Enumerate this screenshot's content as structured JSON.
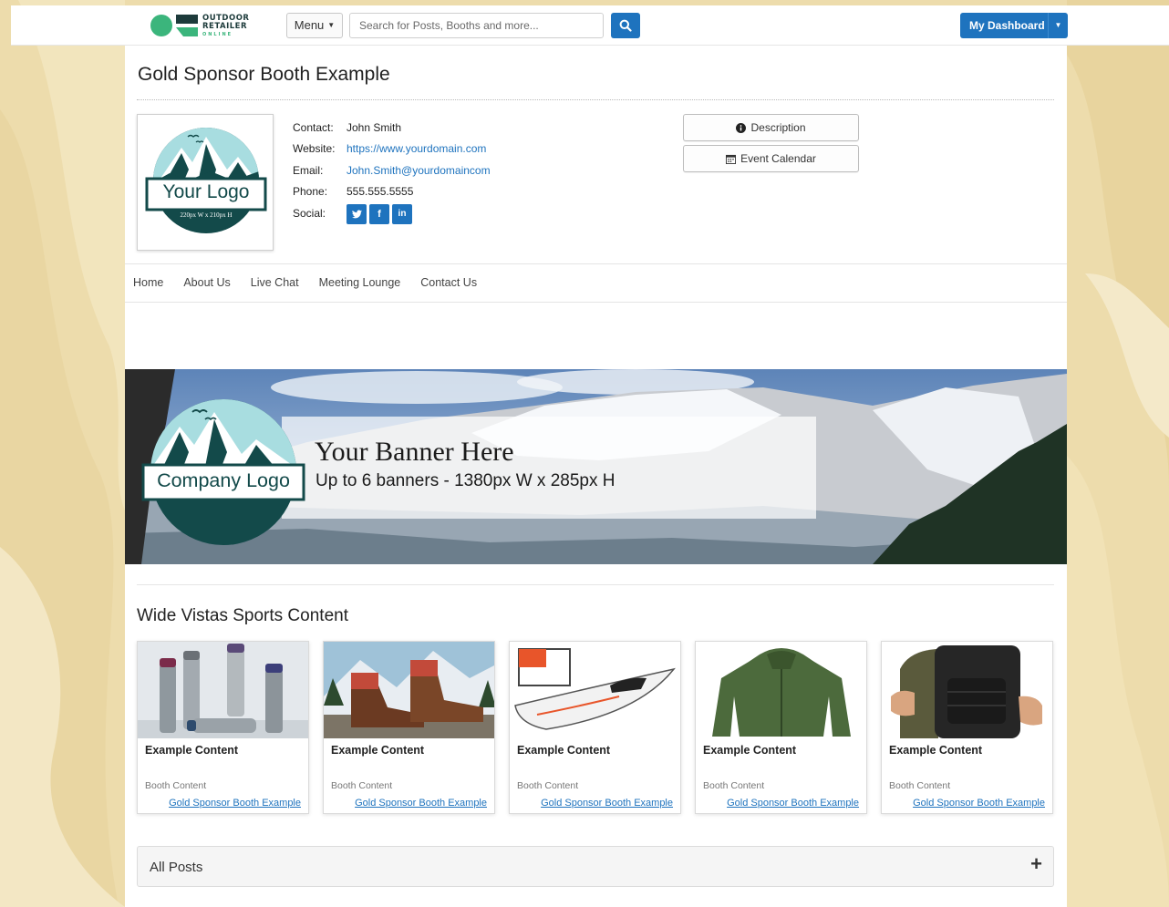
{
  "colors": {
    "background": "#eddcac",
    "primary": "#1e73be",
    "logo_teal": "#134a4a",
    "logo_green": "#3bb57c",
    "card_border": "#dadada"
  },
  "topbar": {
    "logo_alt": "Outdoor Retailer Online",
    "logo_line1": "OUTDOOR",
    "logo_line2": "RETAILER",
    "logo_line3": "ONLINE",
    "menu_label": "Menu",
    "search_placeholder": "Search for Posts, Booths and more...",
    "search_icon": "search-icon",
    "dashboard_label": "My Dashboard"
  },
  "booth": {
    "title": "Gold Sponsor Booth Example",
    "logo": {
      "main_text": "Your Logo",
      "size_text": "220px W x 210px H"
    },
    "contact": {
      "contact_label": "Contact:",
      "contact_value": "John Smith",
      "website_label": "Website:",
      "website_value": "https://www.yourdomain.com",
      "email_label": "Email:",
      "email_value": "John.Smith@yourdomaincom",
      "phone_label": "Phone:",
      "phone_value": "555.555.5555",
      "social_label": "Social:",
      "social_icons": [
        "twitter-icon",
        "facebook-icon",
        "linkedin-icon"
      ]
    },
    "buttons": {
      "description": "Description",
      "event_calendar": "Event Calendar"
    },
    "tabs": [
      "Home",
      "About Us",
      "Live Chat",
      "Meeting Lounge",
      "Contact Us"
    ]
  },
  "banner": {
    "logo_text": "Company Logo",
    "title": "Your Banner Here",
    "subtitle": "Up to 6 banners - 1380px W x 285px H"
  },
  "content_section": {
    "title": "Wide Vistas Sports Content",
    "cards": [
      {
        "image": "water-bottles",
        "title": "Example Content",
        "booth_label": "Booth Content",
        "link": "Gold Sponsor Booth Example"
      },
      {
        "image": "hiking-boots",
        "title": "Example Content",
        "booth_label": "Booth Content",
        "link": "Gold Sponsor Booth Example"
      },
      {
        "image": "kayak",
        "title": "Example Content",
        "booth_label": "Booth Content",
        "link": "Gold Sponsor Booth Example"
      },
      {
        "image": "green-jacket",
        "title": "Example Content",
        "booth_label": "Booth Content",
        "link": "Gold Sponsor Booth Example"
      },
      {
        "image": "backpack",
        "title": "Example Content",
        "booth_label": "Booth Content",
        "link": "Gold Sponsor Booth Example"
      }
    ]
  },
  "all_posts": {
    "label": "All Posts",
    "expand_icon": "plus-icon"
  }
}
